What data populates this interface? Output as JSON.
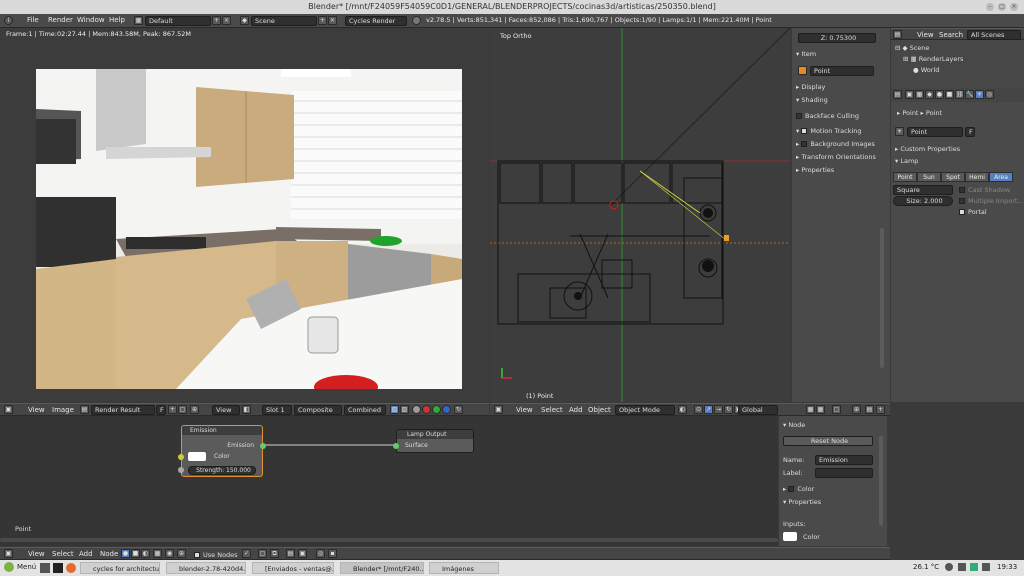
{
  "window": {
    "title": "Blender* [/mnt/F24059F54059C0D1/GENERAL/BLENDERPROJECTS/cocinas3d/artisticas/250350.blend]"
  },
  "menubar": {
    "items": [
      "File",
      "Render",
      "Window",
      "Help"
    ],
    "layout": "Default",
    "scene": "Scene",
    "engine": "Cycles Render",
    "stats": "v2.78.5 | Verts:851,341 | Faces:852,086 | Tris:1,690,767 | Objects:1/90 | Lamps:1/1 | Mem:221.40M | Point"
  },
  "render_view": {
    "info": "Frame:1 | Time:02:27.44 | Mem:843.58M, Peak: 867.52M",
    "header": {
      "view": "View",
      "image": "Image",
      "image_name": "Render Result",
      "fake": "F",
      "view2": "View",
      "slot": "Slot 1",
      "pass": "Composite",
      "layer": "Combined"
    }
  },
  "viewport_3d": {
    "label": "Top Ortho",
    "object": "(1) Point",
    "header": {
      "view": "View",
      "select": "Select",
      "add": "Add",
      "object": "Object",
      "mode": "Object Mode",
      "orientation": "Global"
    }
  },
  "properties_n": {
    "z_label": "Z:",
    "z_value": "0.75300",
    "item_section": "Item",
    "item_name": "Point",
    "display": "Display",
    "shading": "Shading",
    "backface": "Backface Culling",
    "motion_tracking": "Motion Tracking",
    "background_images": "Background Images",
    "transform_orientations": "Transform Orientations",
    "properties": "Properties"
  },
  "outliner": {
    "view": "View",
    "search": "Search",
    "filter": "All Scenes",
    "items": [
      "Scene",
      "RenderLayers",
      "World"
    ]
  },
  "lamp_props": {
    "breadcrumb1": "Point",
    "breadcrumb2": "Point",
    "datablock": "Point",
    "fake": "F",
    "custom_props": "Custom Properties",
    "lamp": "Lamp",
    "types": [
      "Point",
      "Sun",
      "Spot",
      "Hemi",
      "Area"
    ],
    "shape": "Square",
    "size_label": "Size:",
    "size_value": "2.000",
    "cast_shadow": "Cast Shadow",
    "multiple_importance": "Multiple Import...",
    "portal": "Portal"
  },
  "node_editor": {
    "status": "Point",
    "emission": {
      "title": "Emission",
      "output": "Emission",
      "color": "Color",
      "strength_label": "Strength:",
      "strength_value": "150.000"
    },
    "lamp_output": {
      "title": "Lamp Output",
      "input": "Surface"
    },
    "header": {
      "view": "View",
      "select": "Select",
      "add": "Add",
      "node": "Node",
      "use_nodes": "Use Nodes"
    }
  },
  "node_props": {
    "node": "Node",
    "reset": "Reset Node",
    "name_label": "Name:",
    "name_value": "Emission",
    "label_label": "Label:",
    "color": "Color",
    "properties": "Properties",
    "inputs": "Inputs:",
    "color_input": "Color"
  },
  "taskbar": {
    "menu": "Menú",
    "tasks": [
      "cycles for architectu...",
      "blender-2.78-420d4...",
      "[Enviados - ventas@...",
      "Blender* [/mnt/F240...",
      "Imágenes"
    ],
    "temp": "26.1 °C",
    "time": "19:33"
  }
}
